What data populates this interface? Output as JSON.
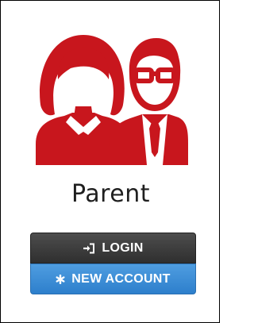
{
  "colors": {
    "illustration": "#c8161d",
    "login_button": "#3a3a3a",
    "new_account_button": "#3b8bd6"
  },
  "card": {
    "title": "Parent",
    "illustration_icon": "parents-icon",
    "buttons": {
      "login": {
        "label": "LOGIN",
        "icon": "sign-in-icon"
      },
      "new_account": {
        "label": "NEW ACCOUNT",
        "icon": "asterisk-icon"
      }
    }
  }
}
